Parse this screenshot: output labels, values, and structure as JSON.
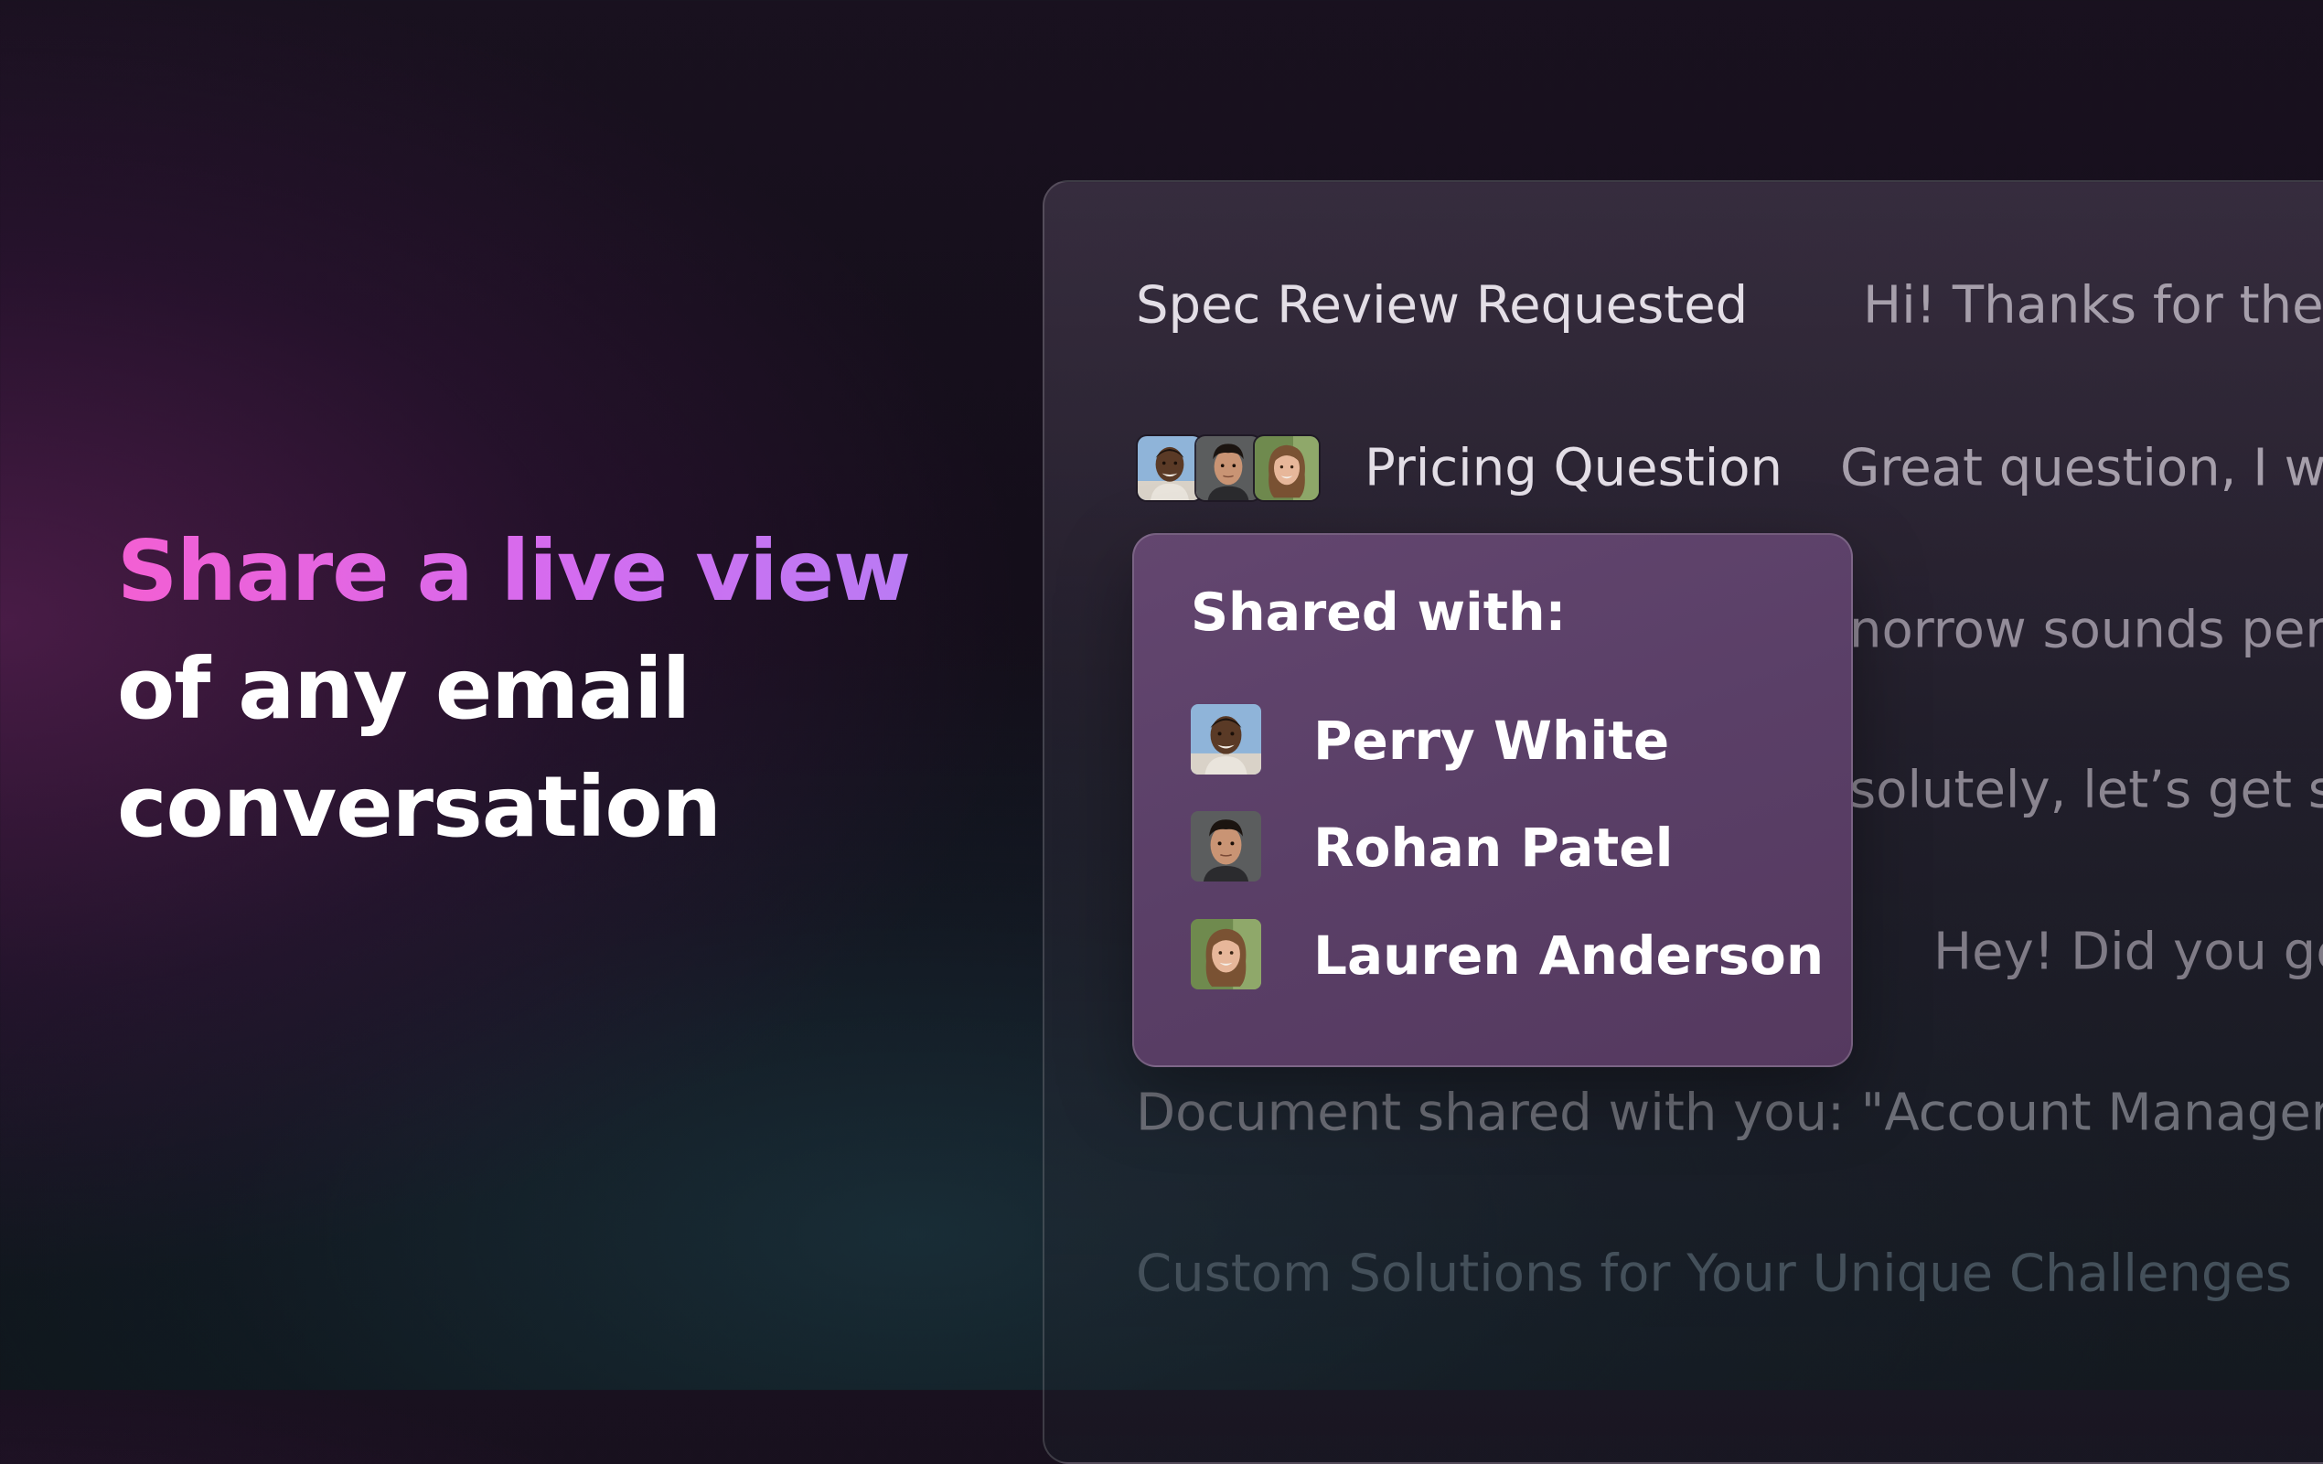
{
  "hero": {
    "line1": "Share a live view",
    "line2": "of any email",
    "line3": "conversation"
  },
  "colors": {
    "accent_start": "#f35fd3",
    "accent_end": "#b77cf4",
    "popover_bg": "#5d4169"
  },
  "inbox": {
    "rows": [
      {
        "subject": "Spec Review Requested",
        "preview": "Hi! Thanks for the i"
      },
      {
        "subject": "Pricing Question",
        "preview": "Great question, I wi",
        "shared_avatars": [
          "avatar-perry-white",
          "avatar-rohan-patel",
          "avatar-lauren-anderson"
        ]
      },
      {
        "preview": "norrow sounds perf"
      },
      {
        "preview": "solutely, let’s get so"
      },
      {
        "preview": "Hey! Did you get"
      },
      {
        "text": "Document shared with you: \"Account Manager H"
      },
      {
        "text": "Custom Solutions for Your Unique Challenges"
      }
    ]
  },
  "share_popover": {
    "title": "Shared with:",
    "people": [
      {
        "name": "Perry White",
        "avatar": "avatar-perry-white"
      },
      {
        "name": "Rohan Patel",
        "avatar": "avatar-rohan-patel"
      },
      {
        "name": "Lauren Anderson",
        "avatar": "avatar-lauren-anderson"
      }
    ]
  }
}
